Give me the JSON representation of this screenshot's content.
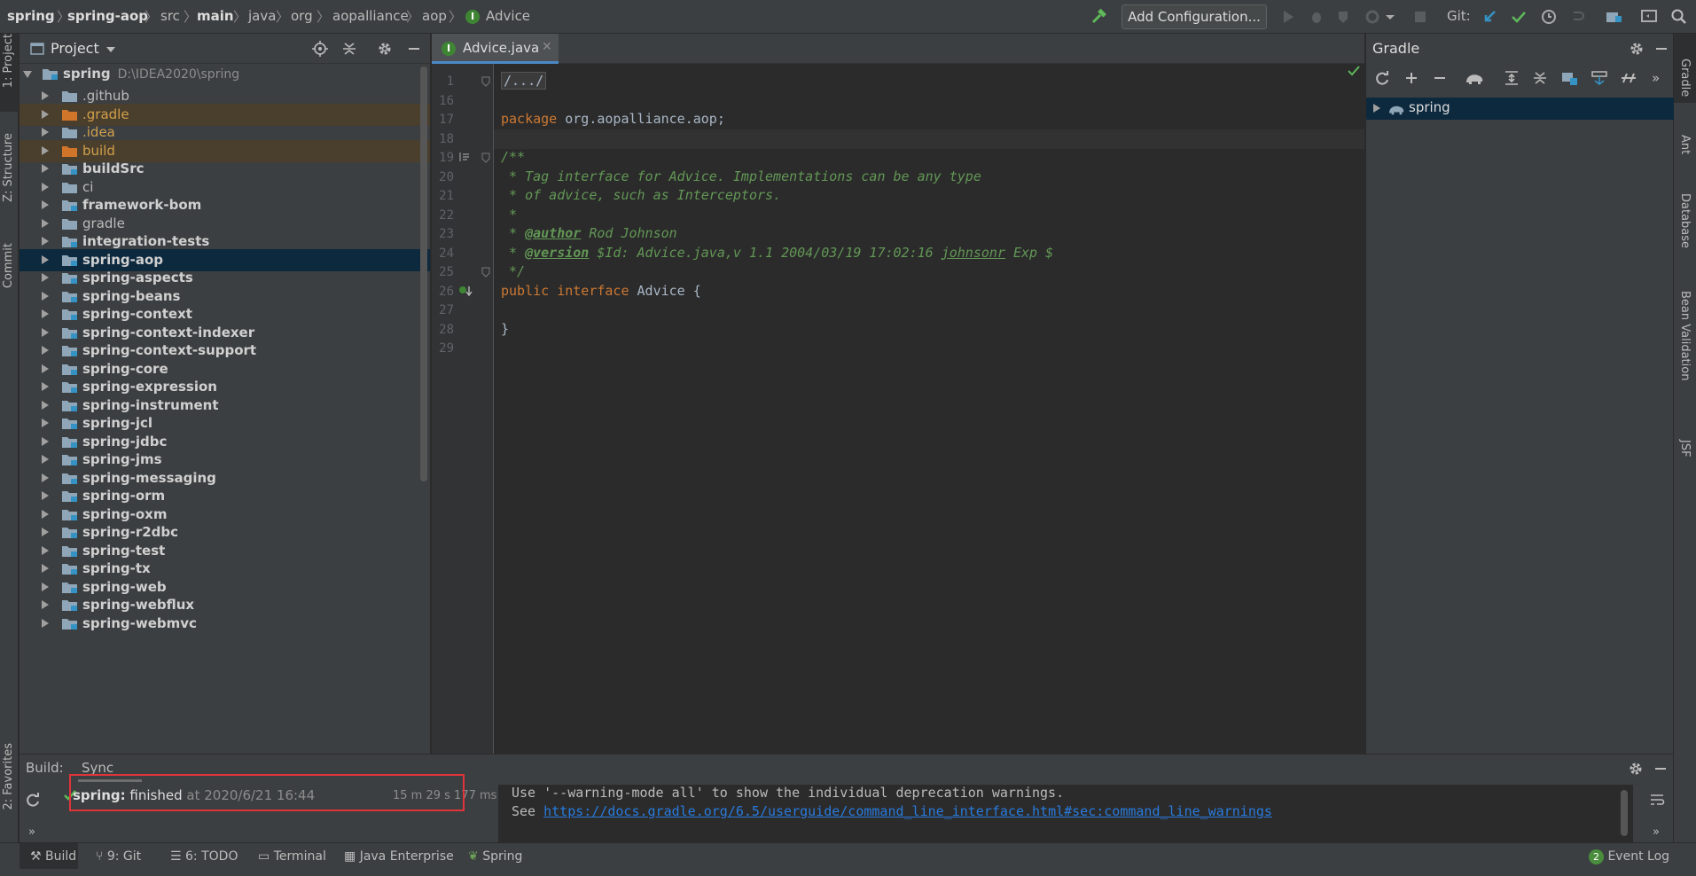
{
  "breadcrumbs": [
    "spring",
    "spring-aop",
    "src",
    "main",
    "java",
    "org",
    "aopalliance",
    "aop",
    "Advice"
  ],
  "toolbar": {
    "add_config_label": "Add Configuration...",
    "git_label": "Git:"
  },
  "left_strip": {
    "project_tab": "1: Project",
    "structure_tab": "Z: Structure",
    "commit_tab": "Commit",
    "favorites_tab": "2: Favorites"
  },
  "right_strip": {
    "gradle_tab": "Gradle",
    "ant_tab": "Ant",
    "database_tab": "Database",
    "bean_tab": "Bean Validation",
    "jsf_tab": "JSF"
  },
  "project": {
    "title": "Project",
    "root_name": "spring",
    "root_path": "D:\\IDEA2020\\spring",
    "items": [
      {
        "label": ".github",
        "style": "normal",
        "kind": "plain"
      },
      {
        "label": ".gradle",
        "style": "orange",
        "kind": "excluded"
      },
      {
        "label": ".idea",
        "style": "orange",
        "kind": "plain"
      },
      {
        "label": "build",
        "style": "orange",
        "kind": "excluded"
      },
      {
        "label": "buildSrc",
        "style": "bold",
        "kind": "module"
      },
      {
        "label": "ci",
        "style": "normal",
        "kind": "plain"
      },
      {
        "label": "framework-bom",
        "style": "bold",
        "kind": "module"
      },
      {
        "label": "gradle",
        "style": "normal",
        "kind": "plain"
      },
      {
        "label": "integration-tests",
        "style": "bold",
        "kind": "module"
      },
      {
        "label": "spring-aop",
        "style": "bold",
        "kind": "module"
      },
      {
        "label": "spring-aspects",
        "style": "bold",
        "kind": "module"
      },
      {
        "label": "spring-beans",
        "style": "bold",
        "kind": "module"
      },
      {
        "label": "spring-context",
        "style": "bold",
        "kind": "module"
      },
      {
        "label": "spring-context-indexer",
        "style": "bold",
        "kind": "module"
      },
      {
        "label": "spring-context-support",
        "style": "bold",
        "kind": "module"
      },
      {
        "label": "spring-core",
        "style": "bold",
        "kind": "module"
      },
      {
        "label": "spring-expression",
        "style": "bold",
        "kind": "module"
      },
      {
        "label": "spring-instrument",
        "style": "bold",
        "kind": "module"
      },
      {
        "label": "spring-jcl",
        "style": "bold",
        "kind": "module"
      },
      {
        "label": "spring-jdbc",
        "style": "bold",
        "kind": "module"
      },
      {
        "label": "spring-jms",
        "style": "bold",
        "kind": "module"
      },
      {
        "label": "spring-messaging",
        "style": "bold",
        "kind": "module"
      },
      {
        "label": "spring-orm",
        "style": "bold",
        "kind": "module"
      },
      {
        "label": "spring-oxm",
        "style": "bold",
        "kind": "module"
      },
      {
        "label": "spring-r2dbc",
        "style": "bold",
        "kind": "module"
      },
      {
        "label": "spring-test",
        "style": "bold",
        "kind": "module"
      },
      {
        "label": "spring-tx",
        "style": "bold",
        "kind": "module"
      },
      {
        "label": "spring-web",
        "style": "bold",
        "kind": "module"
      },
      {
        "label": "spring-webflux",
        "style": "bold",
        "kind": "module"
      },
      {
        "label": "spring-webmvc",
        "style": "bold",
        "kind": "module"
      }
    ],
    "selected": "spring-aop"
  },
  "editor": {
    "tab_name": "Advice.java",
    "lines": [
      {
        "n": "1",
        "html": "<span class=\"fold\">/.../</span>"
      },
      {
        "n": "16",
        "html": ""
      },
      {
        "n": "17",
        "html": "<span class=\"kw\">package</span> org.aopalliance.aop;"
      },
      {
        "n": "18",
        "html": ""
      },
      {
        "n": "19",
        "html": "<span class=\"cm\">/**</span>"
      },
      {
        "n": "20",
        "html": "<span class=\"cm\"> * Tag interface for Advice. Implementations can be any type</span>"
      },
      {
        "n": "21",
        "html": "<span class=\"cm\"> * of advice, such as Interceptors.</span>"
      },
      {
        "n": "22",
        "html": "<span class=\"cm\"> *</span>"
      },
      {
        "n": "23",
        "html": "<span class=\"cm\"> * </span><span class=\"tag\">@author</span><span class=\"cm\"> Rod Johnson</span>"
      },
      {
        "n": "24",
        "html": "<span class=\"cm\"> * </span><span class=\"tag\">@version</span><span class=\"cm\"> $Id: Advice.java,v 1.1 2004/03/19 17:02:16 </span><span class=\"cm und\">johnsonr</span><span class=\"cm\"> Exp $</span>"
      },
      {
        "n": "25",
        "html": "<span class=\"cm\"> */</span>"
      },
      {
        "n": "26",
        "html": "<span class=\"kw\">public interface</span> Advice {"
      },
      {
        "n": "27",
        "html": ""
      },
      {
        "n": "28",
        "html": "}"
      },
      {
        "n": "29",
        "html": ""
      }
    ]
  },
  "gradle": {
    "title": "Gradle",
    "root": "spring"
  },
  "build": {
    "title": "Build:",
    "sync_tab": "Sync",
    "project": "spring:",
    "status": "finished",
    "at_time": "at 2020/6/21 16:44",
    "duration": "15 m 29 s 177 ms",
    "console_line1": "Use '--warning-mode all' to show the individual deprecation warnings.",
    "console_see": "See ",
    "console_link": "https://docs.gradle.org/6.5/userguide/command_line_interface.html#sec:command_line_warnings"
  },
  "bottom_tabs": {
    "build": "Build",
    "git": "9: Git",
    "todo": "6: TODO",
    "terminal": "Terminal",
    "java_ee": "Java Enterprise",
    "spring": "Spring",
    "event_log": "Event Log",
    "event_count": "2"
  },
  "colors": {
    "selection": "#0d293e",
    "accent": "#4a88c7",
    "keyword": "#cc7832",
    "comment": "#629755",
    "highlight_box": "#e0343a"
  }
}
